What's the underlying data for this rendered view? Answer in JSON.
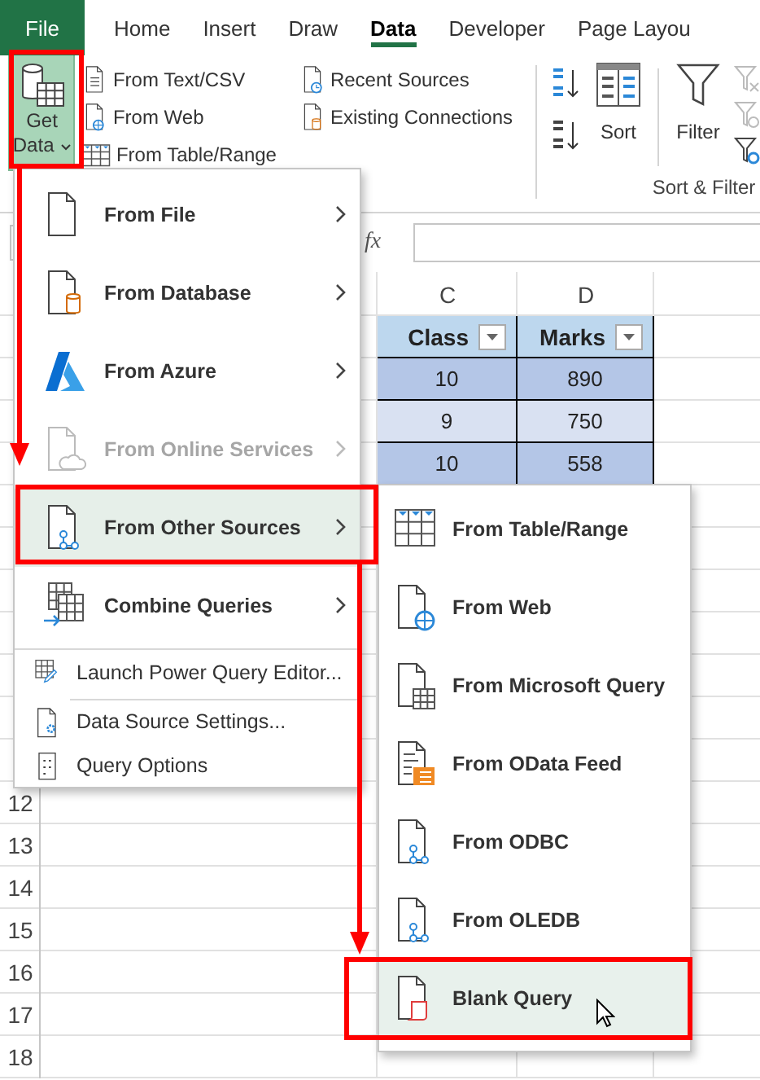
{
  "tabs": [
    {
      "label": "File",
      "kind": "file",
      "selected": false
    },
    {
      "label": "Home",
      "kind": "tab",
      "selected": false
    },
    {
      "label": "Insert",
      "kind": "tab",
      "selected": false
    },
    {
      "label": "Draw",
      "kind": "tab",
      "selected": false
    },
    {
      "label": "Data",
      "kind": "tab",
      "selected": true
    },
    {
      "label": "Developer",
      "kind": "tab",
      "selected": false
    },
    {
      "label": "Page Layou",
      "kind": "tab",
      "selected": false
    }
  ],
  "ribbon": {
    "get_data": {
      "label": "Get Data",
      "selected": true
    },
    "get_transform": [
      "From Text/CSV",
      "From Web",
      "From Table/Range"
    ],
    "queries": [
      "Recent Sources",
      "Existing Connections"
    ],
    "sort": "Sort",
    "filter": "Filter",
    "group_label": "Sort & Filter"
  },
  "formula_bar": {
    "fx": "fx"
  },
  "sheet": {
    "columns": [
      "C",
      "D"
    ],
    "table": {
      "columns": [
        "Class",
        "Marks"
      ],
      "rows": [
        [
          "10",
          "890"
        ],
        [
          "9",
          "750"
        ],
        [
          "10",
          "558"
        ]
      ]
    },
    "row_numbers": [
      "12",
      "13",
      "14",
      "15",
      "16",
      "17",
      "18"
    ]
  },
  "menu": {
    "items": [
      {
        "label": "From File",
        "kind": "large",
        "disabled": false,
        "selected": false,
        "submenu": true
      },
      {
        "label": "From Database",
        "kind": "large",
        "disabled": false,
        "selected": false,
        "submenu": true
      },
      {
        "label": "From Azure",
        "kind": "large",
        "disabled": false,
        "selected": false,
        "submenu": true
      },
      {
        "label": "From Online Services",
        "kind": "large",
        "disabled": true,
        "selected": false,
        "submenu": true
      },
      {
        "label": "From Other Sources",
        "kind": "large",
        "disabled": false,
        "selected": true,
        "submenu": true
      },
      {
        "label": "Combine Queries",
        "kind": "large",
        "disabled": false,
        "selected": false,
        "submenu": true
      },
      {
        "label": "Launch Power Query Editor...",
        "kind": "small",
        "disabled": false,
        "selected": false,
        "submenu": false,
        "separator": true
      },
      {
        "label": "Data Source Settings...",
        "kind": "small",
        "disabled": false,
        "selected": false,
        "submenu": false,
        "separator": true
      },
      {
        "label": "Query Options",
        "kind": "small",
        "disabled": false,
        "selected": false,
        "submenu": false,
        "separator": false
      }
    ]
  },
  "submenu": {
    "items": [
      {
        "label": "From Table/Range",
        "selected": false
      },
      {
        "label": "From Web",
        "selected": false
      },
      {
        "label": "From Microsoft Query",
        "selected": false
      },
      {
        "label": "From OData Feed",
        "selected": false
      },
      {
        "label": "From ODBC",
        "selected": false
      },
      {
        "label": "From OLEDB",
        "selected": false
      },
      {
        "label": "Blank Query",
        "selected": true
      }
    ]
  }
}
